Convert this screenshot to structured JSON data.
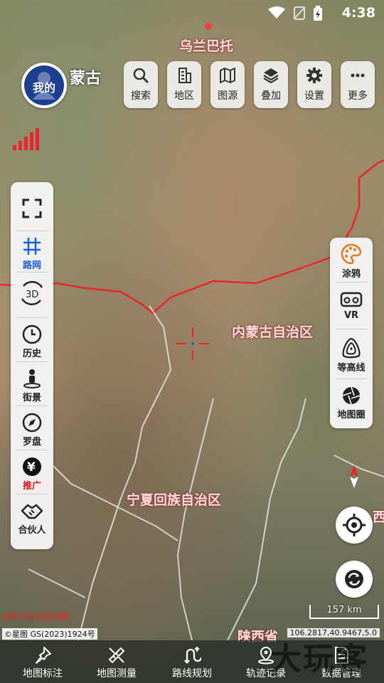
{
  "status": {
    "time": "4:38"
  },
  "map": {
    "labels": {
      "ulaanbaatar": "乌兰巴托",
      "inner_mongolia": "内蒙古自治区",
      "ningxia": "宁夏回族自治区",
      "shaanxi": "陕西省",
      "edge_partial": "西"
    },
    "border_color": "#e8262b"
  },
  "header": {
    "avatar_text": "我的",
    "region": "蒙古"
  },
  "toolbar": {
    "search": "搜索",
    "region": "地区",
    "source": "图源",
    "overlay": "叠加",
    "settings": "设置",
    "more": "更多"
  },
  "left_panel": {
    "road_net": "路网",
    "history": "历史",
    "street_view": "街景",
    "compass": "罗盘",
    "promote": "推广",
    "partner": "合伙人"
  },
  "right_panel": {
    "graffiti": "涂鸦",
    "vr": "VR",
    "contour": "等高线",
    "map_circle": "地图圈"
  },
  "footer": {
    "scale": "157 km",
    "copyright": "©星图 GS(2023)1924号",
    "disclaimer": "边界不全克此刻断",
    "coords": "106.2817,40.9467,5.0",
    "watermark": "大玩客"
  },
  "bottom_nav": {
    "annotate": "地图标注",
    "measure": "地图测量",
    "route": "路线规划",
    "track": "轨迹记录",
    "data": "数据管理"
  },
  "colors": {
    "accent_blue": "#1a5fd8",
    "promote_red": "#d81818",
    "avatar_bg": "#1d3f8f"
  }
}
